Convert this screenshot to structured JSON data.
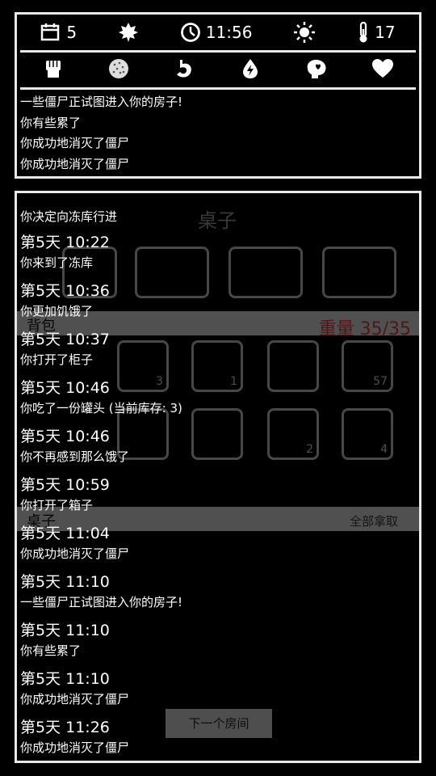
{
  "status": {
    "day": "5",
    "time": "11:56",
    "temperature": "17"
  },
  "icons": {
    "top": [
      "calendar-icon",
      "leaf-icon",
      "clock-icon",
      "sun-icon",
      "thermometer-icon"
    ],
    "needs": [
      "fist-icon",
      "round-grain-icon",
      "stomach-icon",
      "lightning-drop-icon",
      "brain-heart-icon",
      "heart-icon"
    ]
  },
  "status_messages": [
    "一些僵尸正试图进入你的房子!",
    "你有些累了",
    "你成功地消灭了僵尸",
    "你成功地消灭了僵尸"
  ],
  "scene": {
    "title": "桌子",
    "backpack_label": "背包",
    "weight_label": "重量 35/35",
    "table_label": "桌子",
    "take_all_label": "全部拿取",
    "next_room_label": "下一个房间",
    "slot_counts": [
      "3",
      "1",
      "57",
      "2",
      "4"
    ]
  },
  "log": {
    "intro": "你决定向冻库行进",
    "entries": [
      {
        "time": "第5天 10:22",
        "text": "你来到了冻库"
      },
      {
        "time": "第5天 10:36",
        "text": "你更加饥饿了"
      },
      {
        "time": "第5天 10:37",
        "text": "你打开了柜子"
      },
      {
        "time": "第5天 10:46",
        "text": "你吃了一份罐头 (当前库存: 3)"
      },
      {
        "time": "第5天 10:46",
        "text": "你不再感到那么饿了"
      },
      {
        "time": "第5天 10:59",
        "text": "你打开了箱子"
      },
      {
        "time": "第5天 11:04",
        "text": "你成功地消灭了僵尸"
      },
      {
        "time": "第5天 11:10",
        "text": "一些僵尸正试图进入你的房子!"
      },
      {
        "time": "第5天 11:10",
        "text": "你有些累了"
      },
      {
        "time": "第5天 11:10",
        "text": "你成功地消灭了僵尸"
      },
      {
        "time": "第5天 11:26",
        "text": "你成功地消灭了僵尸"
      }
    ]
  }
}
